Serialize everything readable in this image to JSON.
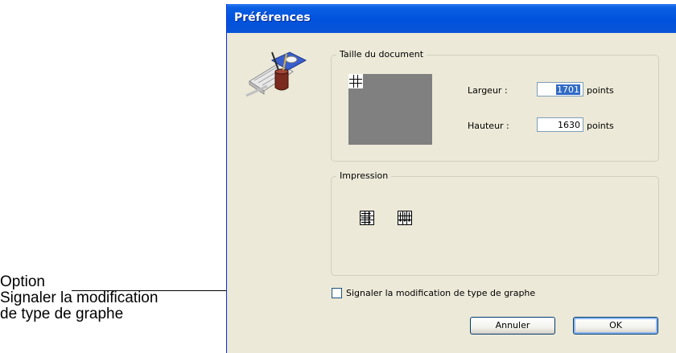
{
  "callout": {
    "line1": "Option",
    "line2": "Signaler la modification",
    "line3": "de type de graphe"
  },
  "dialog": {
    "title": "Préférences",
    "document_size": {
      "legend": "Taille du document",
      "width_label": "Largeur :",
      "width_value": "1701",
      "height_label": "Hauteur :",
      "height_value": "1630",
      "unit": "points"
    },
    "print": {
      "legend": "Impression"
    },
    "checkbox": {
      "label": "Signaler la modification de type de graphe",
      "checked": false
    },
    "buttons": {
      "cancel": "Annuler",
      "ok": "OK"
    }
  }
}
